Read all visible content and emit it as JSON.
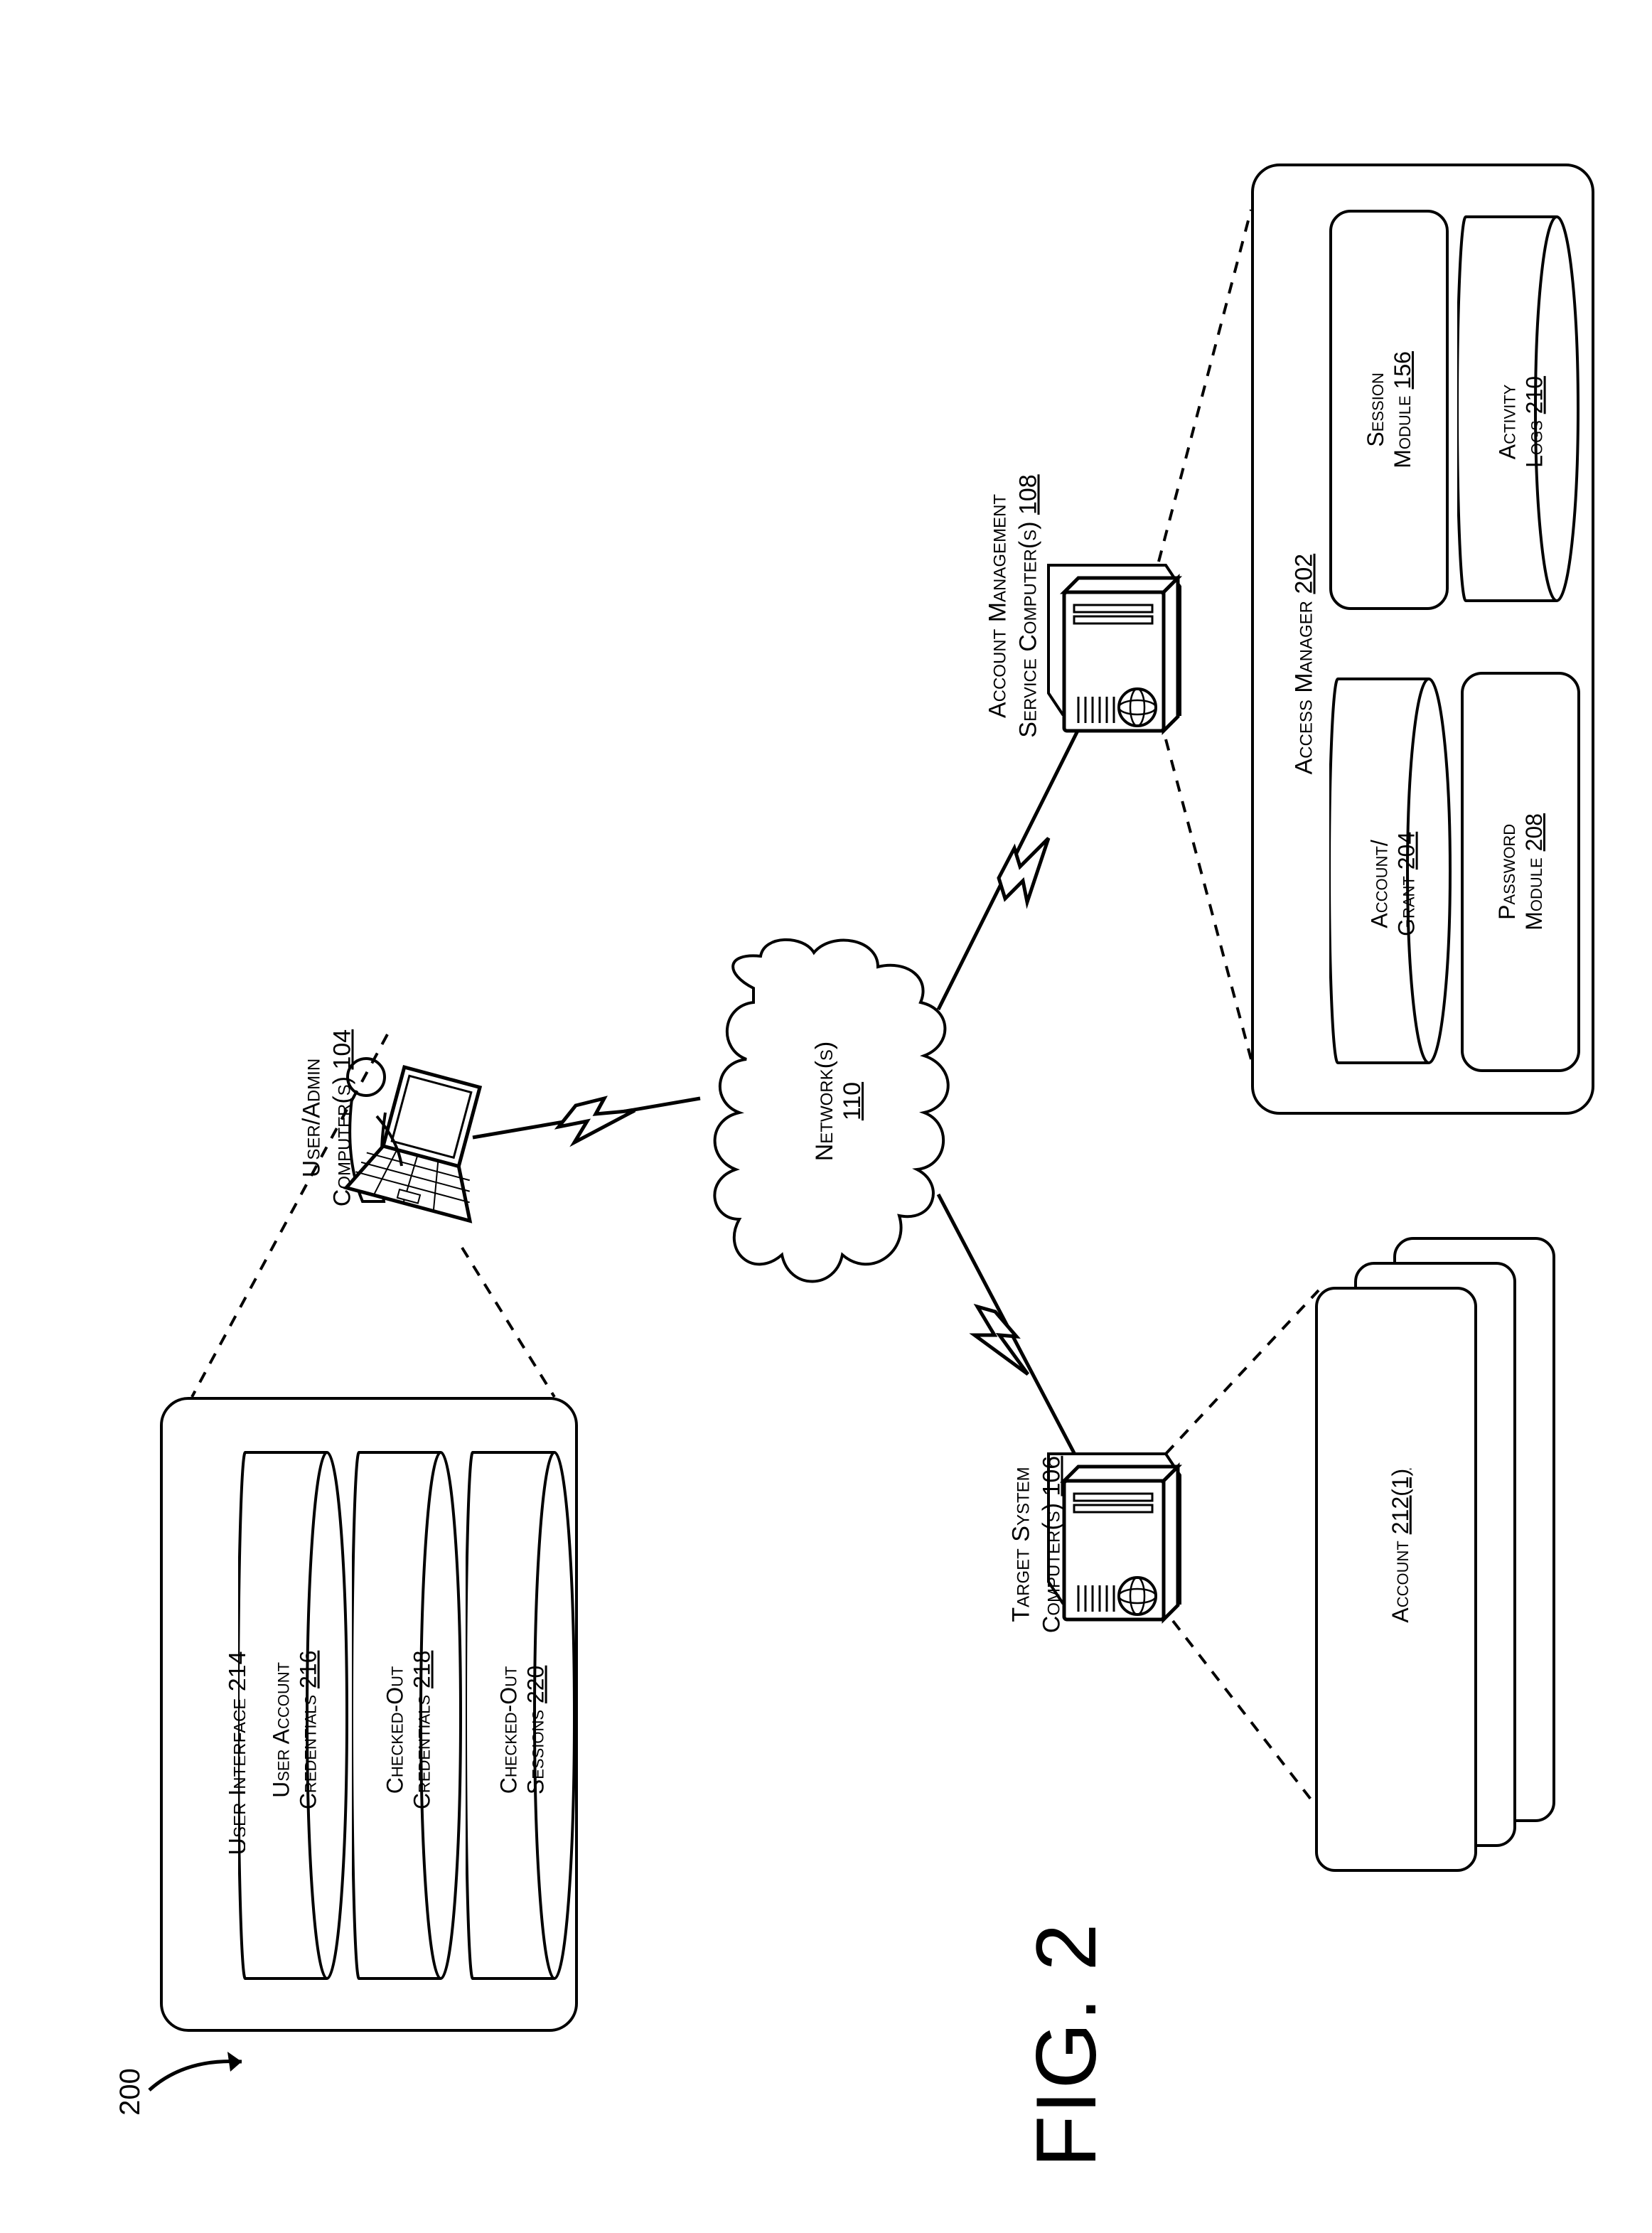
{
  "figure_label": "FIG. 2",
  "figure_ref": "200",
  "network": {
    "label": "Network(s)",
    "num": "110"
  },
  "user_admin": {
    "label_l1": "User/Admin",
    "label_l2": "Computer(s)",
    "num": "104"
  },
  "acct_mgmt": {
    "label_l1": "Account Management",
    "label_l2": "Service Computer(s)",
    "num": "108"
  },
  "target_sys": {
    "label_l1": "Target System",
    "label_l2": "Computer(s)",
    "num": "106"
  },
  "access_manager": {
    "label": "Access Manager",
    "num": "202"
  },
  "account_grant": {
    "label_l1": "Account/",
    "label_l2": "Grant",
    "num": "204"
  },
  "session_module": {
    "label_l1": "Session",
    "label_l2": "Module",
    "num": "156"
  },
  "password_module": {
    "label_l1": "Password",
    "label_l2": "Module",
    "num": "208"
  },
  "activity_logs": {
    "label_l1": "Activity",
    "label_l2": "Logs",
    "num": "210"
  },
  "account_card": {
    "label": "Account",
    "num": "212(1)"
  },
  "user_interface": {
    "label": "User Interface",
    "num": "214"
  },
  "user_account_credentials": {
    "label_l1": "User Account",
    "label_l2": "Credentials",
    "num": "216"
  },
  "checked_out_credentials": {
    "label_l1": "Checked-Out",
    "label_l2": "Credentials",
    "num": "218"
  },
  "checked_out_sessions": {
    "label_l1": "Checked-Out",
    "label_l2": "Sessions",
    "num": "220"
  }
}
